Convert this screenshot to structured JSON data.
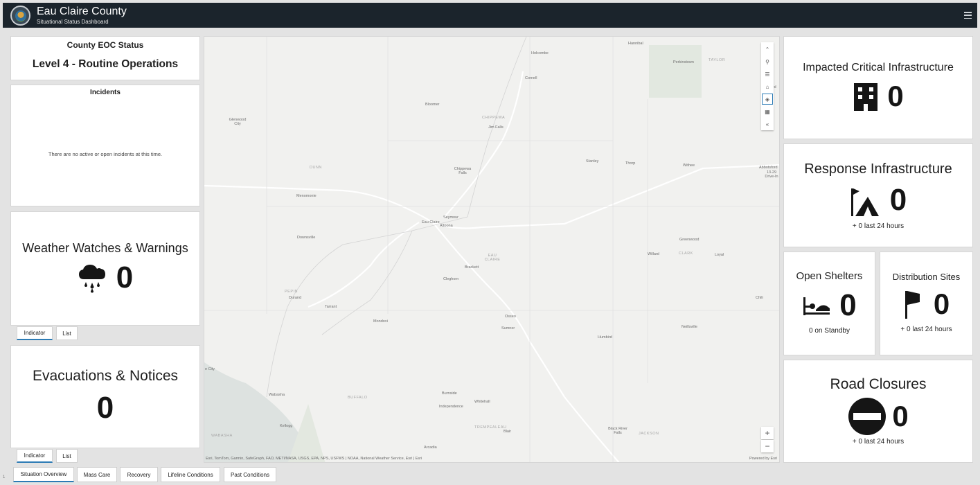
{
  "header": {
    "title": "Eau Claire County",
    "subtitle": "Situational Status Dashboard"
  },
  "eoc": {
    "title": "County EOC Status",
    "level": "Level 4 - Routine Operations"
  },
  "incidents": {
    "title": "Incidents",
    "message": "There are no active or open incidents at this time."
  },
  "weather": {
    "title": "Weather Watches & Warnings",
    "value": "0",
    "icon": "rain-cloud-icon"
  },
  "weather_tabs": [
    "Indicator",
    "List"
  ],
  "evacuations": {
    "title": "Evacuations & Notices",
    "value": "0"
  },
  "evac_tabs": [
    "Indicator",
    "List"
  ],
  "impacted": {
    "title": "Impacted Critical Infrastructure",
    "value": "0",
    "icon": "building-icon"
  },
  "response": {
    "title": "Response Infrastructure",
    "value": "0",
    "sub": "+ 0 last 24 hours",
    "icon": "flag-tent-icon"
  },
  "shelters": {
    "title": "Open Shelters",
    "value": "0",
    "sub": "0 on Standby",
    "icon": "cot-icon"
  },
  "distribution": {
    "title": "Distribution Sites",
    "value": "0",
    "sub": "+ 0 last 24 hours",
    "icon": "flag-icon"
  },
  "roads": {
    "title": "Road Closures",
    "value": "0",
    "sub": "+ 0 last 24 hours",
    "icon": "no-entry-icon"
  },
  "map": {
    "places": [
      "Hannibal",
      "Holcombe",
      "Perkinstown",
      "Cornell",
      "Bloomer",
      "Jim Falls",
      "Glenwood City",
      "Chippewa Falls",
      "Stanley",
      "Thorp",
      "Withee",
      "Abbotsford",
      "13-29 Drive-In",
      "Menomonie",
      "Seymour",
      "Eau Claire",
      "Altoona",
      "Downsville",
      "Greenwood",
      "Willard",
      "Loyal",
      "Brackett",
      "Cleghorn",
      "Durand",
      "Tarrant",
      "Chili",
      "Mondovi",
      "Osseo",
      "Sumner",
      "Humbird",
      "Neillsville",
      "Burnside",
      "Independence",
      "Whitehall",
      "Wabasha",
      "Kellogg",
      "Blair",
      "Black River Falls",
      "Arcadia",
      "Med",
      "e City"
    ],
    "counties": [
      "TAYLOR",
      "CHIPPEWA",
      "DUNN",
      "EAU CLAIRE",
      "CLARK",
      "PEPIN",
      "BUFFALO",
      "TREMPEALEAU",
      "JACKSON",
      "WABASHA"
    ],
    "attribution": "Esri, TomTom, Garmin, SafeGraph, FAO, METI/NASA, USGS, EPA, NPS, USFWS | NOAA, National Weather Service, Esri | Esri",
    "powered": "Powered by Esri",
    "zoom_in": "+",
    "zoom_out": "−"
  },
  "bottom_tabs": [
    "Situation Overview",
    "Mass Care",
    "Recovery",
    "Lifeline Conditions",
    "Past Conditions"
  ],
  "bottom_marker": "1"
}
